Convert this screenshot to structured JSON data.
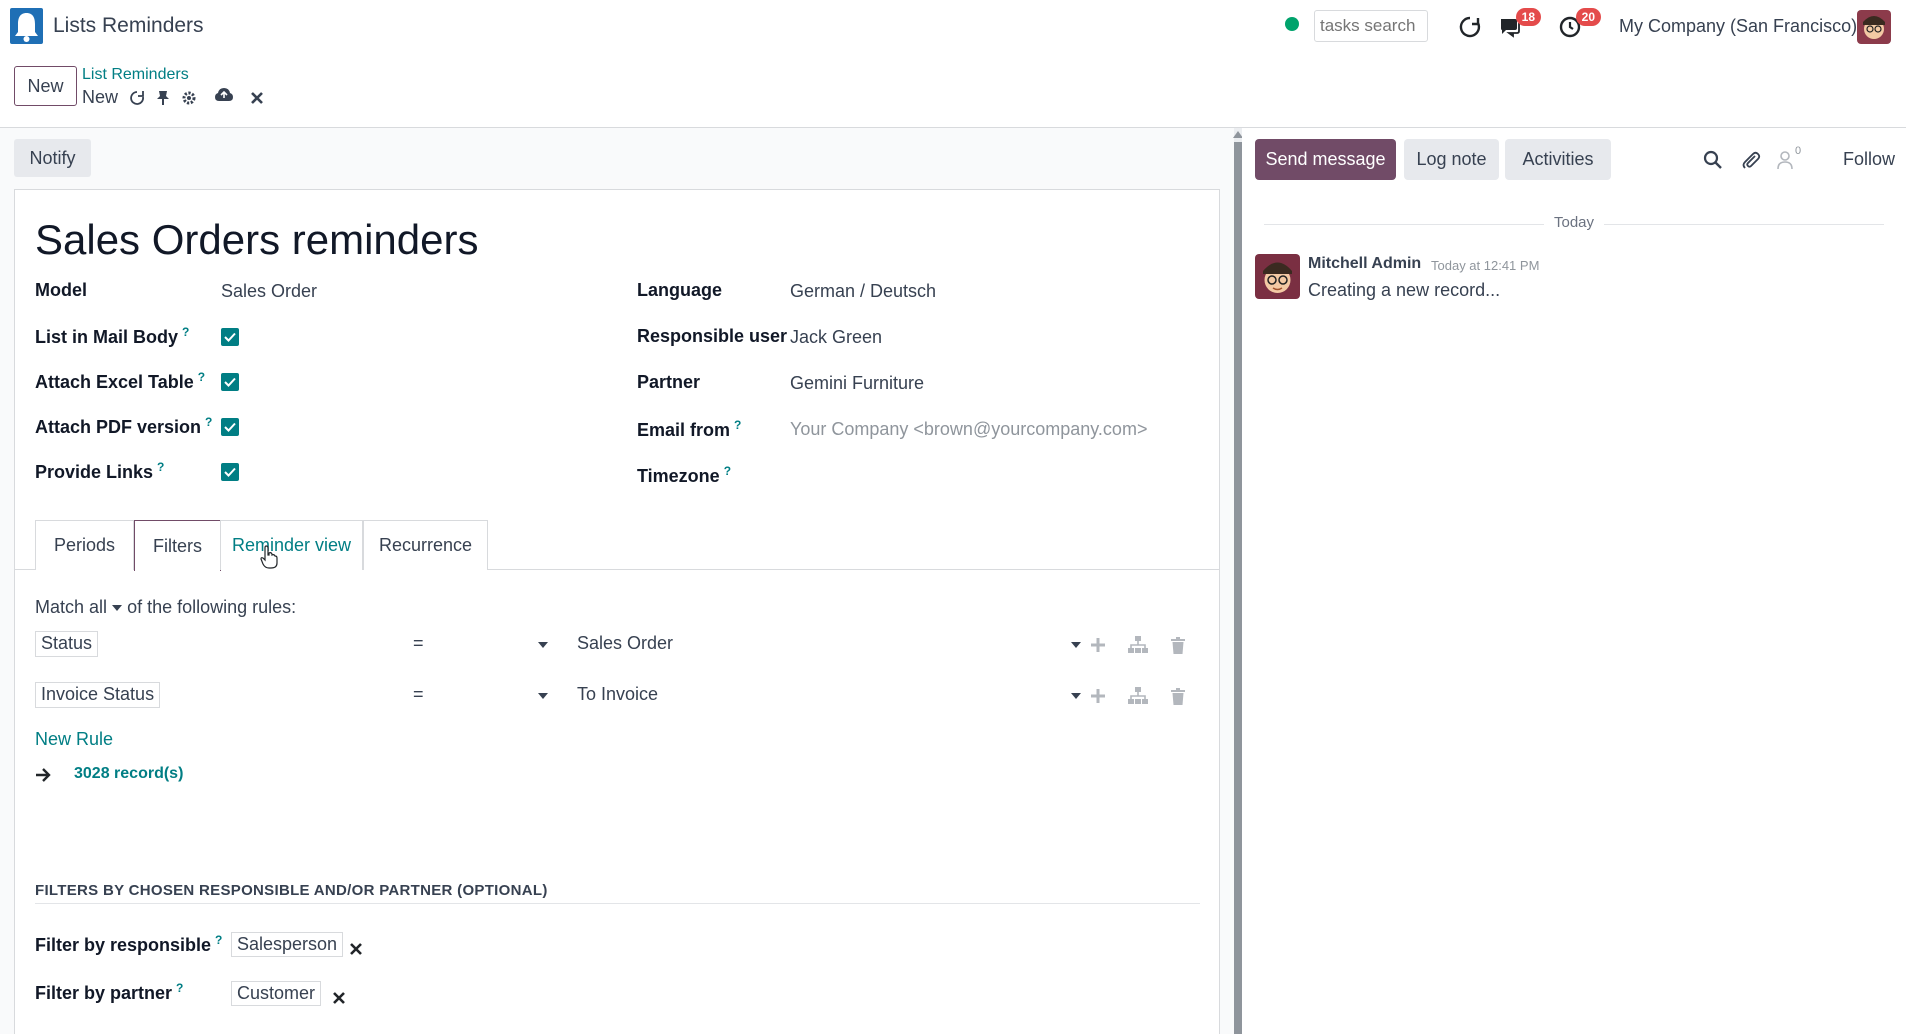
{
  "app": {
    "title": "Lists Reminders",
    "search_placeholder": "tasks search",
    "messages_count": "18",
    "activities_count": "20",
    "company": "My Company (San Francisco)",
    "status_color": "#00a36c"
  },
  "control": {
    "new_label": "New",
    "breadcrumb_parent": "List Reminders",
    "breadcrumb_current": "New"
  },
  "form": {
    "notify_label": "Notify",
    "title": "Sales Orders reminders",
    "left_fields": [
      {
        "label": "Model",
        "value": "Sales Order"
      },
      {
        "label": "List in Mail Body",
        "help": "?",
        "checked": true
      },
      {
        "label": "Attach Excel Table",
        "help": "?",
        "checked": true
      },
      {
        "label": "Attach PDF version",
        "help": "?",
        "checked": true
      },
      {
        "label": "Provide Links",
        "help": "?",
        "checked": true
      }
    ],
    "right_fields": [
      {
        "label": "Language",
        "value": "German / Deutsch"
      },
      {
        "label": "Responsible user",
        "value": "Jack Green"
      },
      {
        "label": "Partner",
        "value": "Gemini Furniture"
      },
      {
        "label": "Email from",
        "help": "?",
        "placeholder": "Your Company <brown@yourcompany.com>"
      },
      {
        "label": "Timezone",
        "help": "?",
        "value": ""
      }
    ],
    "tabs": [
      {
        "label": "Periods"
      },
      {
        "label": "Filters",
        "active": true
      },
      {
        "label": "Reminder view"
      },
      {
        "label": "Recurrence"
      }
    ],
    "match": {
      "prefix": "Match",
      "mode": "all",
      "suffix": "of the following rules:"
    },
    "rules": [
      {
        "path": "Status",
        "operator": "=",
        "value": "Sales Order"
      },
      {
        "path": "Invoice Status",
        "operator": "=",
        "value": "To Invoice"
      }
    ],
    "new_rule_label": "New Rule",
    "records_label": "3028 record(s)",
    "section_title": "FILTERS BY CHOSEN RESPONSIBLE AND/OR PARTNER (OPTIONAL)",
    "filter_responsible": {
      "label": "Filter by responsible",
      "help": "?",
      "tag": "Salesperson"
    },
    "filter_partner": {
      "label": "Filter by partner",
      "help": "?",
      "tag": "Customer"
    }
  },
  "chatter": {
    "send_label": "Send message",
    "log_label": "Log note",
    "activities_label": "Activities",
    "followers_count": "0",
    "follow_label": "Follow",
    "day_label": "Today",
    "message": {
      "author": "Mitchell Admin",
      "date": "Today at 12:41 PM",
      "body": "Creating a new record..."
    }
  },
  "colors": {
    "primary": "#714b67",
    "accent": "#017e84",
    "badge": "#e44b4b"
  }
}
